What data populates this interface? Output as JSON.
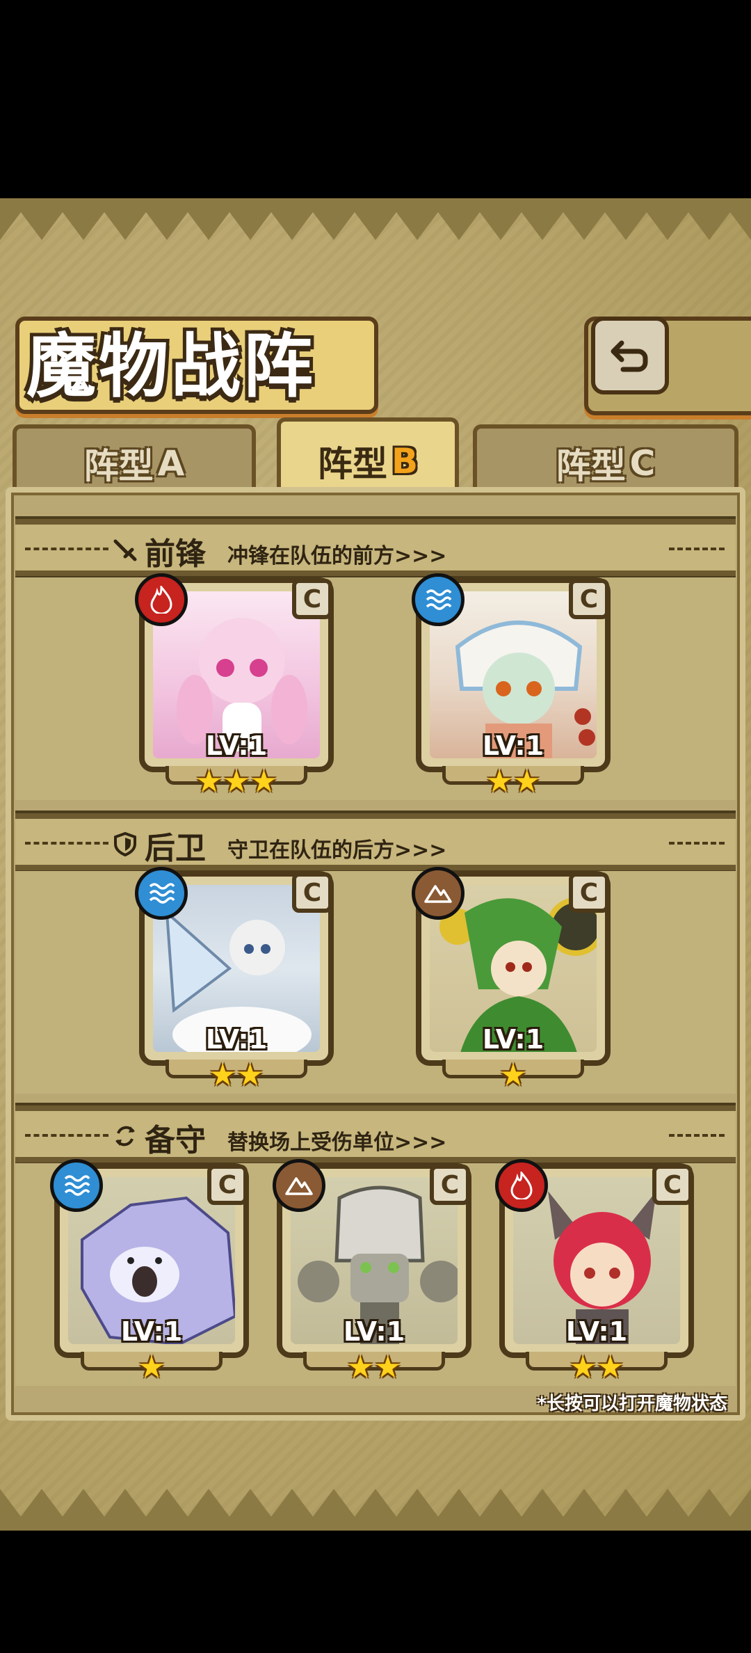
{
  "header": {
    "title": "魔物战阵",
    "back_icon": "return-arrow-icon"
  },
  "tabs": [
    {
      "label": "阵型",
      "letter": "A",
      "active": false
    },
    {
      "label": "阵型",
      "letter": "B",
      "active": true
    },
    {
      "label": "阵型",
      "letter": "C",
      "active": false
    }
  ],
  "sections": {
    "front": {
      "title": "前锋",
      "desc": "冲锋在队伍的前方>>>",
      "icon": "sword-icon"
    },
    "rear": {
      "title": "后卫",
      "desc": "守卫在队伍的后方>>>",
      "icon": "shield-icon"
    },
    "reserve": {
      "title": "备守",
      "desc": "替换场上受伤单位>>>",
      "icon": "swap-icon"
    }
  },
  "monsters": {
    "front1": {
      "level": "LV:1",
      "stars": "★★★",
      "grade": "C",
      "element": "fire"
    },
    "front2": {
      "level": "LV:1",
      "stars": "★★",
      "grade": "C",
      "element": "water"
    },
    "rear1": {
      "level": "LV:1",
      "stars": "★★",
      "grade": "C",
      "element": "water"
    },
    "rear2": {
      "level": "LV:1",
      "stars": "★",
      "grade": "C",
      "element": "earth"
    },
    "res1": {
      "level": "LV:1",
      "stars": "★",
      "grade": "C",
      "element": "water"
    },
    "res2": {
      "level": "LV:1",
      "stars": "★★",
      "grade": "C",
      "element": "earth"
    },
    "res3": {
      "level": "LV:1",
      "stars": "★★",
      "grade": "C",
      "element": "fire"
    }
  },
  "footer": {
    "hint": "*长按可以打开魔物状态"
  },
  "colors": {
    "fire": "#c7231f",
    "water": "#2f8ed4",
    "earth": "#8a5a34",
    "star": "#ffd21c"
  }
}
